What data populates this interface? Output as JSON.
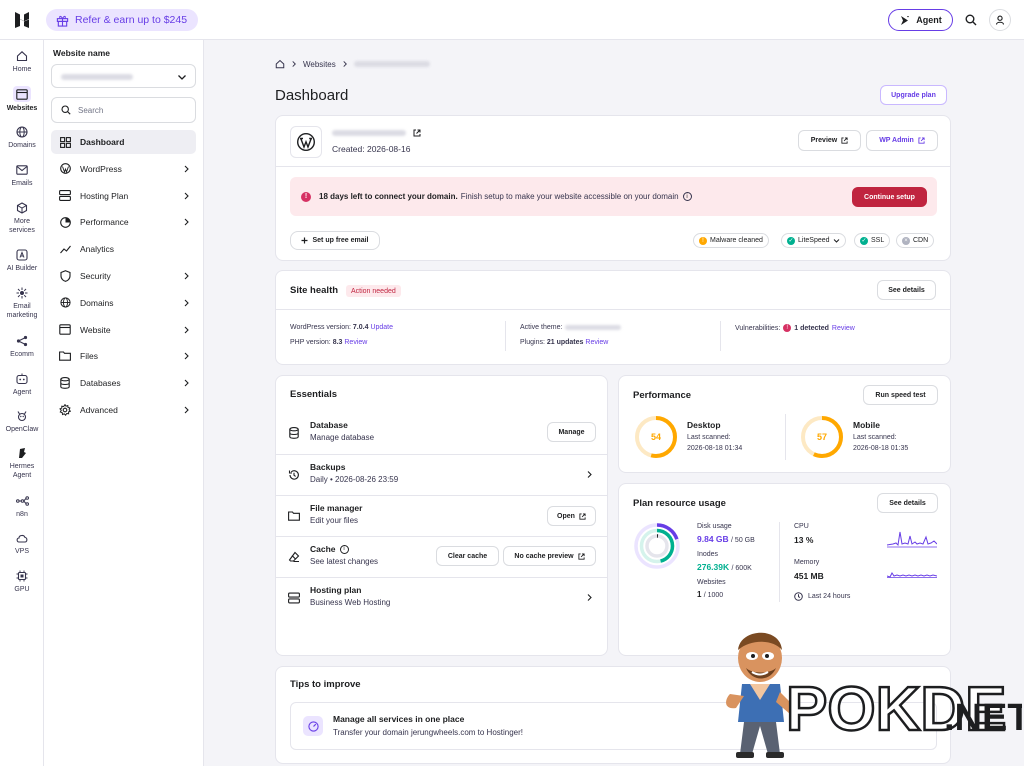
{
  "topbar": {
    "refer_label": "Refer & earn up to $245",
    "agent_label": "Agent"
  },
  "rail": [
    {
      "label": "Home",
      "icon": "home-icon"
    },
    {
      "label": "Websites",
      "icon": "websites-icon",
      "active": true
    },
    {
      "label": "Domains",
      "icon": "globe-icon"
    },
    {
      "label": "Emails",
      "icon": "mail-icon"
    },
    {
      "label": "More services",
      "icon": "more-services-icon"
    },
    {
      "label": "AI Builder",
      "icon": "ai-builder-icon"
    },
    {
      "label": "Email marketing",
      "icon": "email-marketing-icon"
    },
    {
      "label": "Ecomm",
      "icon": "ecomm-icon"
    },
    {
      "label": "Agent",
      "icon": "agent-icon"
    },
    {
      "label": "OpenClaw",
      "icon": "openclaw-icon"
    },
    {
      "label": "Hermes Agent",
      "icon": "hermes-icon"
    },
    {
      "label": "n8n",
      "icon": "n8n-icon"
    },
    {
      "label": "VPS",
      "icon": "vps-icon"
    },
    {
      "label": "GPU",
      "icon": "gpu-icon"
    }
  ],
  "sidebar": {
    "website_name_label": "Website name",
    "search_placeholder": "Search",
    "items": [
      {
        "label": "Dashboard",
        "icon": "dashboard-icon",
        "active": true,
        "chevron": false
      },
      {
        "label": "WordPress",
        "icon": "wordpress-icon",
        "chevron": true
      },
      {
        "label": "Hosting Plan",
        "icon": "hosting-icon",
        "chevron": true
      },
      {
        "label": "Performance",
        "icon": "performance-icon",
        "chevron": true
      },
      {
        "label": "Analytics",
        "icon": "analytics-icon",
        "chevron": false
      },
      {
        "label": "Security",
        "icon": "shield-icon",
        "chevron": true
      },
      {
        "label": "Domains",
        "icon": "globe-icon",
        "chevron": true
      },
      {
        "label": "Website",
        "icon": "website-icon",
        "chevron": true
      },
      {
        "label": "Files",
        "icon": "folder-icon",
        "chevron": true
      },
      {
        "label": "Databases",
        "icon": "database-icon",
        "chevron": true
      },
      {
        "label": "Advanced",
        "icon": "gear-icon",
        "chevron": true
      }
    ]
  },
  "breadcrumb": {
    "websites": "Websites"
  },
  "page_title": "Dashboard",
  "upgrade_label": "Upgrade plan",
  "site_card": {
    "created": "Created: 2026-08-16",
    "preview_label": "Preview",
    "wp_admin_label": "WP Admin",
    "alert_bold": "18 days left to connect your domain.",
    "alert_text": "Finish setup to make your website accessible on your domain",
    "continue_label": "Continue setup",
    "free_email_label": "Set up free email",
    "badges": {
      "malware": "Malware cleaned",
      "litespeed": "LiteSpeed",
      "ssl": "SSL",
      "cdn": "CDN"
    }
  },
  "site_health": {
    "title": "Site health",
    "badge": "Action needed",
    "see_details": "See details",
    "wp_version_label": "WordPress version:",
    "wp_version": "7.0.4",
    "update": "Update",
    "php_label": "PHP version:",
    "php_version": "8.3",
    "php_review": "Review",
    "theme_label": "Active theme:",
    "plugins_label": "Plugins:",
    "plugins_value": "21 updates",
    "plugins_review": "Review",
    "vuln_label": "Vulnerabilities:",
    "vuln_value": "1 detected",
    "vuln_review": "Review"
  },
  "essentials": {
    "title": "Essentials",
    "rows": [
      {
        "title": "Database",
        "sub": "Manage database",
        "action": "Manage"
      },
      {
        "title": "Backups",
        "sub": "Daily • 2026-08-26 23:59"
      },
      {
        "title": "File manager",
        "sub": "Edit your files",
        "action": "Open"
      },
      {
        "title": "Cache",
        "sub": "See latest changes",
        "action1": "Clear cache",
        "action2": "No cache preview"
      },
      {
        "title": "Hosting plan",
        "sub": "Business Web Hosting"
      }
    ]
  },
  "performance": {
    "title": "Performance",
    "run_label": "Run speed test",
    "desktop": {
      "label": "Desktop",
      "score": 54,
      "scanned_label": "Last scanned:",
      "scanned": "2026-08-18 01:34"
    },
    "mobile": {
      "label": "Mobile",
      "score": 57,
      "scanned_label": "Last scanned:",
      "scanned": "2026-08-18 01:35"
    }
  },
  "resources": {
    "title": "Plan resource usage",
    "see_details": "See details",
    "disk_label": "Disk usage",
    "disk_value": "9.84 GB",
    "disk_total": "/ 50 GB",
    "inodes_label": "Inodes",
    "inodes_value": "276.39K",
    "inodes_total": "/ 600K",
    "websites_label": "Websites",
    "websites_value": "1",
    "websites_total": "/ 1000",
    "cpu_label": "CPU",
    "cpu_value": "13 %",
    "memory_label": "Memory",
    "memory_value": "451 MB",
    "period": "Last 24 hours"
  },
  "tips": {
    "title": "Tips to improve",
    "item_title": "Manage all services in one place",
    "item_text": "Transfer your domain jerungwheels.com to Hostinger!"
  },
  "watermark": "POKDE.NET",
  "colors": {
    "accent": "#673de6",
    "danger": "#d63163",
    "alert_bg": "#fde9ec",
    "score": "#ffa800",
    "success": "#00b090"
  }
}
